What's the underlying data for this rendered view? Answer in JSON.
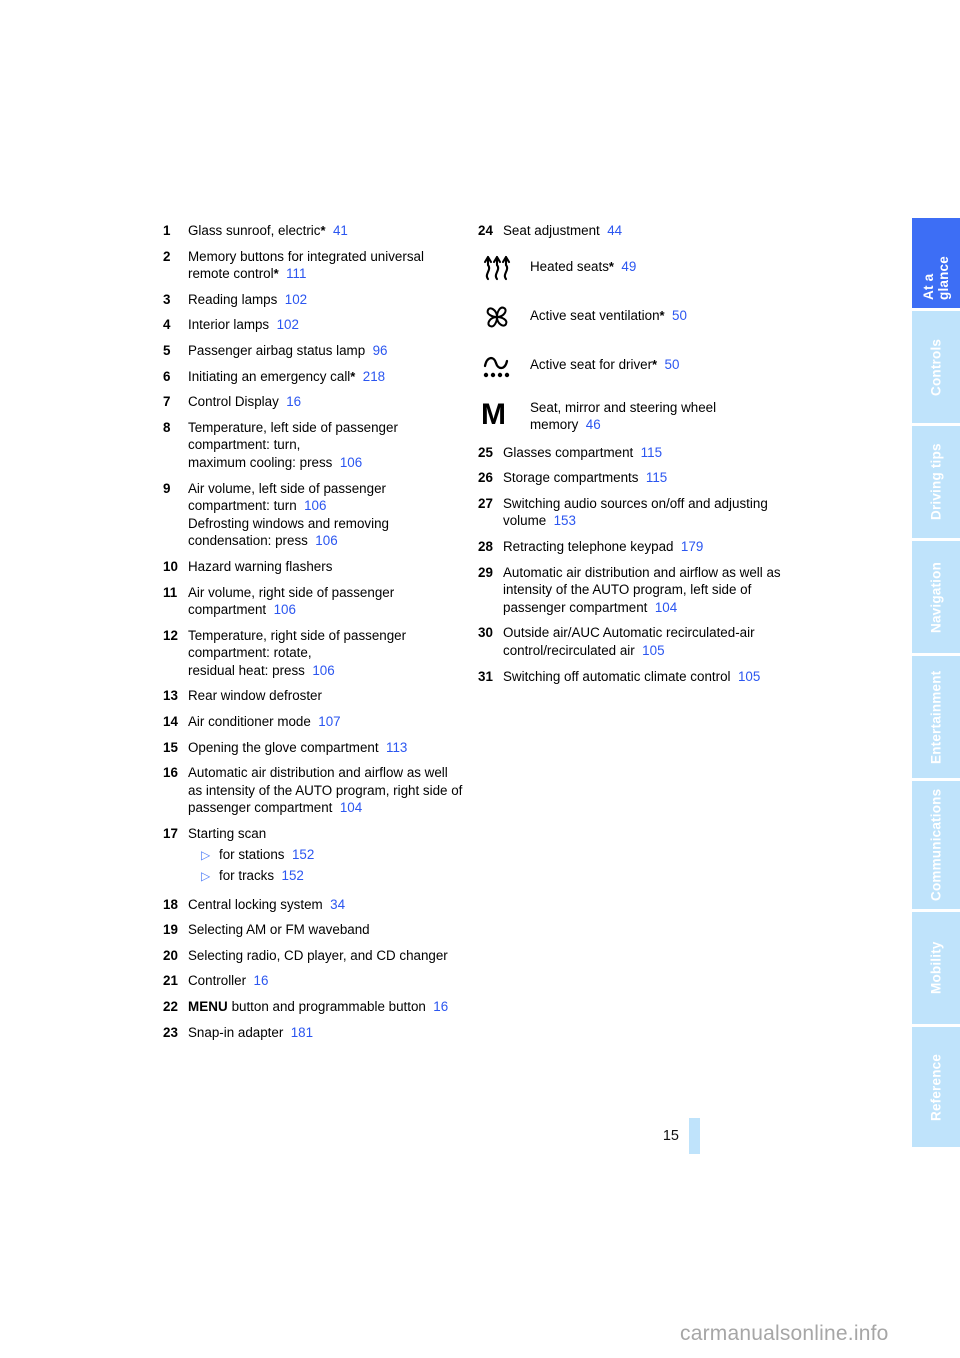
{
  "document": {
    "page_number": "15",
    "watermark": "carmanualsonline.info",
    "accent_blue": "#2b56f0",
    "tab_active_color": "#3d6ef5",
    "tab_inactive_color": "#bfe3fb"
  },
  "tabs": [
    {
      "label": "At a glance",
      "active": true
    },
    {
      "label": "Controls",
      "active": false
    },
    {
      "label": "Driving tips",
      "active": false
    },
    {
      "label": "Navigation",
      "active": false
    },
    {
      "label": "Entertainment",
      "active": false
    },
    {
      "label": "Communications",
      "active": false
    },
    {
      "label": "Mobility",
      "active": false
    },
    {
      "label": "Reference",
      "active": false
    }
  ],
  "left_column": [
    {
      "num": "1",
      "text": "Glass sunroof, electric",
      "star": true,
      "page": "41"
    },
    {
      "num": "2",
      "text": "Memory buttons for integrated universal remote control",
      "star": true,
      "page": "111"
    },
    {
      "num": "3",
      "text": "Reading lamps",
      "star": false,
      "page": "102"
    },
    {
      "num": "4",
      "text": "Interior lamps",
      "star": false,
      "page": "102"
    },
    {
      "num": "5",
      "text": "Passenger airbag status lamp",
      "star": false,
      "page": "96"
    },
    {
      "num": "6",
      "text": "Initiating an emergency call",
      "star": true,
      "page": "218"
    },
    {
      "num": "7",
      "text": "Control Display",
      "star": false,
      "page": "16"
    },
    {
      "num": "8",
      "text": "Temperature, left side of passenger compartment: turn,\nmaximum cooling: press",
      "star": false,
      "page": "106"
    },
    {
      "num": "9",
      "text": "Air volume, left side of passenger compartment: turn",
      "star": false,
      "page": "106",
      "text2": "Defrosting windows and removing condensation: press",
      "page2": "106"
    },
    {
      "num": "10",
      "text": "Hazard warning flashers",
      "star": false,
      "page": ""
    },
    {
      "num": "11",
      "text": "Air volume, right side of passenger compartment",
      "star": false,
      "page": "106"
    },
    {
      "num": "12",
      "text": "Temperature, right side of passenger compartment: rotate,\nresidual heat: press",
      "star": false,
      "page": "106"
    },
    {
      "num": "13",
      "text": "Rear window defroster",
      "star": false,
      "page": ""
    },
    {
      "num": "14",
      "text": "Air conditioner mode",
      "star": false,
      "page": "107"
    },
    {
      "num": "15",
      "text": "Opening the glove compartment",
      "star": false,
      "page": "113"
    },
    {
      "num": "16",
      "text": "Automatic air distribution and airflow as well as intensity of the AUTO program, right side of passenger compartment",
      "star": false,
      "page": "104"
    },
    {
      "num": "17",
      "text": "Starting scan",
      "star": false,
      "page": "",
      "subitems": [
        {
          "bullet": "▷",
          "text": "for stations",
          "page": "152"
        },
        {
          "bullet": "▷",
          "text": "for tracks",
          "page": "152"
        }
      ]
    },
    {
      "num": "18",
      "text": "Central locking system",
      "star": false,
      "page": "34"
    },
    {
      "num": "19",
      "text": "Selecting AM or FM waveband",
      "star": false,
      "page": ""
    },
    {
      "num": "20",
      "text": "Selecting radio, CD player, and CD changer",
      "star": false,
      "page": ""
    },
    {
      "num": "21",
      "text": "Controller",
      "star": false,
      "page": "16"
    },
    {
      "num": "22",
      "keyword": "MENU",
      "text": "button and programmable button",
      "star": false,
      "page": "16"
    },
    {
      "num": "23",
      "text": "Snap-in adapter",
      "star": false,
      "page": "181"
    }
  ],
  "right_column_head": [
    {
      "num": "24",
      "text": "Seat adjustment",
      "star": false,
      "page": "44"
    }
  ],
  "right_column_icons": [
    {
      "icon": "heated-seats-icon",
      "text": "Heated seats",
      "star": true,
      "page": "49"
    },
    {
      "icon": "seat-ventilation-fan-icon",
      "text": "Active seat ventilation",
      "star": true,
      "page": "50"
    },
    {
      "icon": "active-seat-icon",
      "text": "Active seat for driver",
      "star": true,
      "page": "50"
    },
    {
      "icon": "memory-m-icon",
      "glyph": "M",
      "text": "Seat, mirror and steering wheel memory",
      "star": false,
      "page": "46"
    }
  ],
  "right_column": [
    {
      "num": "25",
      "text": "Glasses compartment",
      "star": false,
      "page": "115"
    },
    {
      "num": "26",
      "text": "Storage compartments",
      "star": false,
      "page": "115"
    },
    {
      "num": "27",
      "text": "Switching audio sources on/off and adjusting volume",
      "star": false,
      "page": "153"
    },
    {
      "num": "28",
      "text": "Retracting telephone keypad",
      "star": false,
      "page": "179"
    },
    {
      "num": "29",
      "text": "Automatic air distribution and airflow as well as intensity of the AUTO program, left side of passenger compartment",
      "star": false,
      "page": "104"
    },
    {
      "num": "30",
      "text": "Outside air/AUC Automatic recirculated-air control/recirculated air",
      "star": false,
      "page": "105"
    },
    {
      "num": "31",
      "text": "Switching off automatic climate control",
      "star": false,
      "page": "105"
    }
  ]
}
